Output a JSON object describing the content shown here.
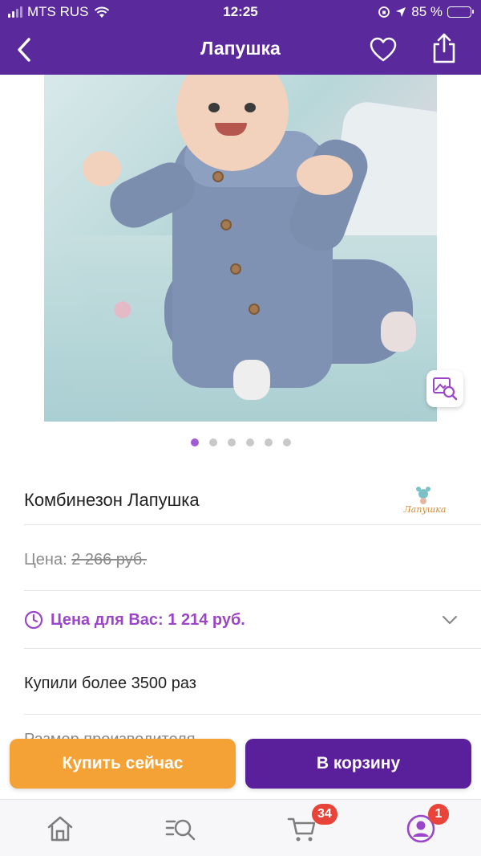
{
  "status": {
    "carrier": "MTS RUS",
    "time": "12:25",
    "battery": "85 %"
  },
  "header": {
    "title": "Лапушка",
    "back_icon": "back-chevron-icon",
    "favorite_icon": "heart-icon",
    "share_icon": "share-icon"
  },
  "gallery": {
    "image_count": 6,
    "active_index": 0,
    "zoom_icon": "image-search-icon"
  },
  "product": {
    "name": "Комбинезон Лапушка",
    "brand_logo_text": "Лапушка",
    "price_label": "Цена: ",
    "old_price": "2 266 руб.",
    "special_price": "Цена для Вас: 1 214 руб.",
    "bought": "Купили более 3500 раз",
    "size_label": "Размер производителя"
  },
  "actions": {
    "buy_now": "Купить сейчас",
    "add_to_cart": "В корзину"
  },
  "tabbar": {
    "cart_badge": "34",
    "profile_badge": "1"
  },
  "colors": {
    "header_bg": "#5a2a9c",
    "accent_purple": "#9b46c9",
    "buy_now_bg": "#f4a236",
    "cart_button_bg": "#5a1f9a",
    "badge_red": "#e8443a"
  }
}
